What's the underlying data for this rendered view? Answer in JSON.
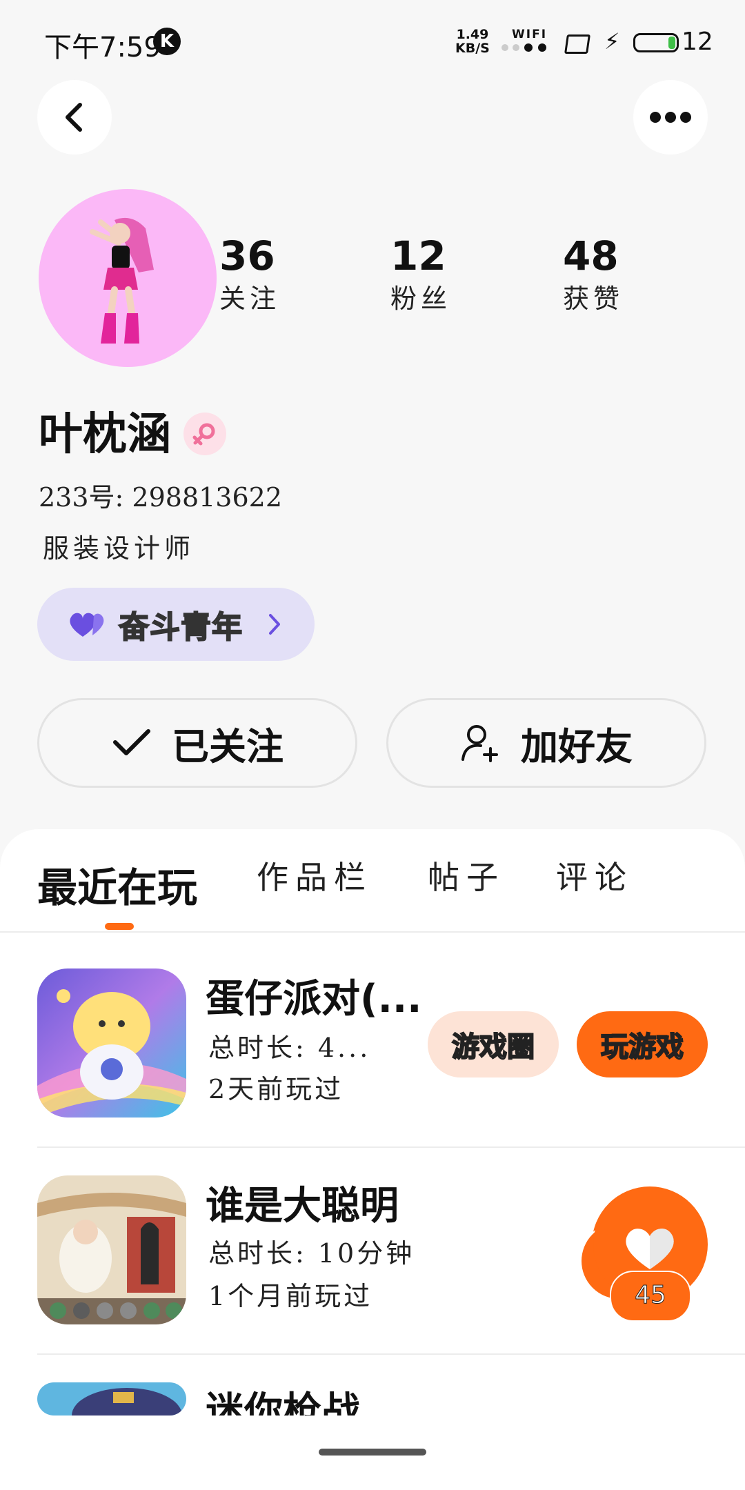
{
  "status_bar": {
    "time": "下午7:59",
    "k_badge": "K",
    "net_speed_value": "1.49",
    "net_speed_unit": "KB/S",
    "wifi_label": "WIFI",
    "battery_level": "12"
  },
  "header": {
    "back_icon": "chevron-left-icon",
    "more_icon": "more-dots-icon"
  },
  "profile": {
    "stats": [
      {
        "value": "36",
        "label": "关注"
      },
      {
        "value": "12",
        "label": "粉丝"
      },
      {
        "value": "48",
        "label": "获赞"
      }
    ],
    "name": "叶枕涵",
    "gender_icon": "female-icon",
    "id_line": "233号: 298813622",
    "bio": "服装设计师",
    "title_chip": {
      "label": "奋斗青年",
      "icon": "heart-icon"
    },
    "buttons": {
      "followed": "已关注",
      "add_friend": "加好友"
    }
  },
  "tabs": [
    "最近在玩",
    "作品栏",
    "帖子",
    "评论"
  ],
  "active_tab": "最近在玩",
  "games": [
    {
      "title": "蛋仔派对(...",
      "duration": "总时长: 4...",
      "last_played": "2天前玩过",
      "actions": {
        "circle": "游戏圈",
        "play": "玩游戏"
      }
    },
    {
      "title": "谁是大聪明",
      "duration": "总时长: 10分钟",
      "last_played": "1个月前玩过"
    },
    {
      "title": "迷你枪战"
    }
  ],
  "like_fab": {
    "count": "45"
  },
  "colors": {
    "accent": "#ff6a13",
    "chip_bg": "#e3e0f7",
    "avatar_bg": "#fbb8f7"
  }
}
